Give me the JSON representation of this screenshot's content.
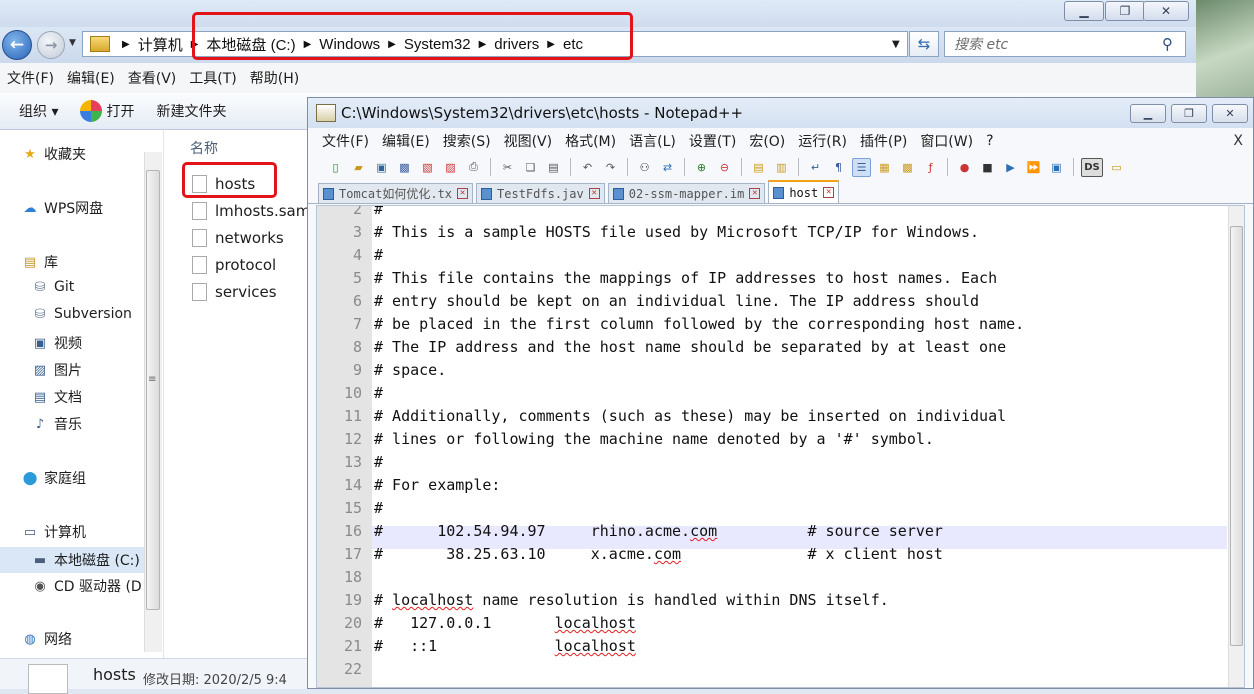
{
  "explorer": {
    "address": {
      "crumbs": [
        "计算机",
        "本地磁盘 (C:)",
        "Windows",
        "System32",
        "drivers",
        "etc"
      ]
    },
    "search": {
      "placeholder": "搜索 etc"
    },
    "menu": [
      "文件(F)",
      "编辑(E)",
      "查看(V)",
      "工具(T)",
      "帮助(H)"
    ],
    "toolbar": {
      "organize": "组织 ▾",
      "open": "打开",
      "new_folder": "新建文件夹"
    },
    "sidebar": {
      "favorites": "收藏夹",
      "wps": "WPS网盘",
      "library": "库",
      "lib_items": [
        "Git",
        "Subversion",
        "视频",
        "图片",
        "文档",
        "音乐"
      ],
      "homegroup": "家庭组",
      "computer": "计算机",
      "drives": [
        "本地磁盘 (C:)",
        "CD 驱动器 (D"
      ],
      "network": "网络"
    },
    "column_header": "名称",
    "files": [
      "hosts",
      "lmhosts.sam",
      "networks",
      "protocol",
      "services"
    ],
    "status": {
      "filename": "hosts",
      "modified": "修改日期: 2020/2/5 9:4"
    }
  },
  "notepad": {
    "title": "C:\\Windows\\System32\\drivers\\etc\\hosts - Notepad++",
    "menu": [
      "文件(F)",
      "编辑(E)",
      "搜索(S)",
      "视图(V)",
      "格式(M)",
      "语言(L)",
      "设置(T)",
      "宏(O)",
      "运行(R)",
      "插件(P)",
      "窗口(W)",
      "?"
    ],
    "close_x": "X",
    "tabs": [
      "Tomcat如何优化.tx",
      "TestFdfs.jav",
      "02-ssm-mapper.im",
      "host"
    ],
    "active_tab": 3,
    "current_line": 16,
    "lines": [
      {
        "n": "2",
        "text": "#"
      },
      {
        "n": "3",
        "text": "# This is a sample HOSTS file used by Microsoft TCP/IP for Windows."
      },
      {
        "n": "4",
        "text": "#"
      },
      {
        "n": "5",
        "text": "# This file contains the mappings of IP addresses to host names. Each"
      },
      {
        "n": "6",
        "text": "# entry should be kept on an individual line. The IP address should"
      },
      {
        "n": "7",
        "text": "# be placed in the first column followed by the corresponding host name."
      },
      {
        "n": "8",
        "text": "# The IP address and the host name should be separated by at least one"
      },
      {
        "n": "9",
        "text": "# space."
      },
      {
        "n": "10",
        "text": "#"
      },
      {
        "n": "11",
        "text": "# Additionally, comments (such as these) may be inserted on individual"
      },
      {
        "n": "12",
        "text": "# lines or following the machine name denoted by a '#' symbol."
      },
      {
        "n": "13",
        "text": "#"
      },
      {
        "n": "14",
        "text": "# For example:"
      },
      {
        "n": "15",
        "text": "#"
      },
      {
        "n": "16",
        "text": "#      102.54.94.97     rhino.acme.com          # source server"
      },
      {
        "n": "17",
        "text": "#       38.25.63.10     x.acme.com              # x client host"
      },
      {
        "n": "18",
        "text": ""
      },
      {
        "n": "19",
        "text": "# localhost name resolution is handled within DNS itself."
      },
      {
        "n": "20",
        "text": "#   127.0.0.1       localhost"
      },
      {
        "n": "21",
        "text": "#   ::1             localhost"
      },
      {
        "n": "22",
        "text": ""
      }
    ]
  },
  "colors": {
    "highlight": "#e2141a",
    "current_line": "#e8e8ff",
    "active_tab_accent": "#f4a21a"
  }
}
